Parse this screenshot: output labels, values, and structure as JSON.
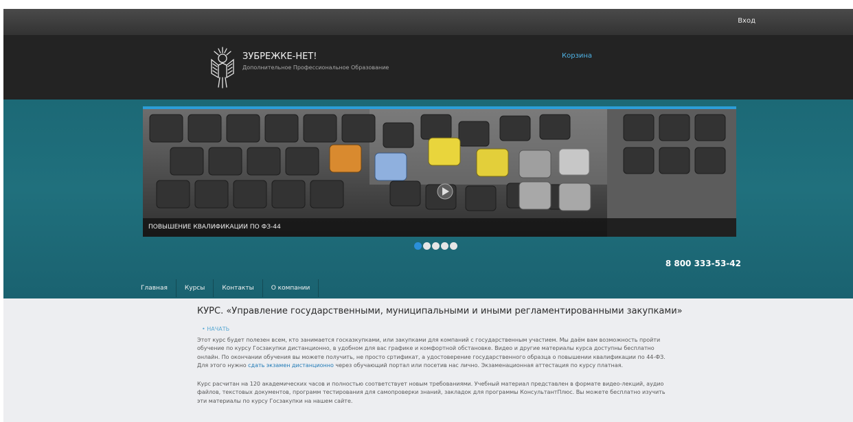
{
  "top_bar": {
    "login_label": "Вход"
  },
  "header": {
    "site_name": "ЗУБРЕЖКЕ-НЕТ!",
    "site_tagline": "Дополнительное Профессиональное Образование",
    "cart_label": "Корзина"
  },
  "slider": {
    "caption": "ПОВЫШЕНИЕ КВАЛИФИКАЦИИ ПО ФЗ-44",
    "dots": 5,
    "active_dot": 0
  },
  "contact": {
    "phone": "8 800 333-53-42"
  },
  "nav": {
    "items": [
      {
        "label": "Главная"
      },
      {
        "label": "Курсы"
      },
      {
        "label": "Контакты"
      },
      {
        "label": "О компании"
      }
    ]
  },
  "content": {
    "title": "КУРС. «Управление государственными, муниципальными и иными регламентированными закупками»",
    "start_link": "НАЧАТЬ",
    "p1_before": "Этот курс будет полезен всем, кто занимается госказкупками, или закупками для компаний с государственным участием. Мы даём вам возможность пройти обучение по курсу Госзакупки дистанционно, в удобном для вас графике и комфортной обстановке. Видео и другие материалы курса доступны бесплатно онлайн. По окончании обучения вы можете получить, не просто сртификат, а удостоверение государственного образца о повышении квалификации по 44-ФЗ. Для этого нужно ",
    "p1_link": "сдать экзамен дистанционно",
    "p1_after": " через обучающий портал или посетив нас лично. Экзаменационная аттестация по курсу платная.",
    "p2": "Курс расчитан на 120 академических часов и полностью соответствует новым требованиями. Учебный материал представлен в формате видео-лекций, аудио файлов, текстовых документов, программ тестирования для самопроверки знаний, закладок для программы КонсультантПлюс. Вы можете бесплатно изучить эти материалы по курсу Госзакупки на нашем сайте."
  },
  "colors": {
    "header_bg": "#232323",
    "teal_band": "#1c6976",
    "accent_blue": "#2b8fd9",
    "content_bg": "#edeef1"
  },
  "icons": [
    "logo-mascot-icon"
  ]
}
